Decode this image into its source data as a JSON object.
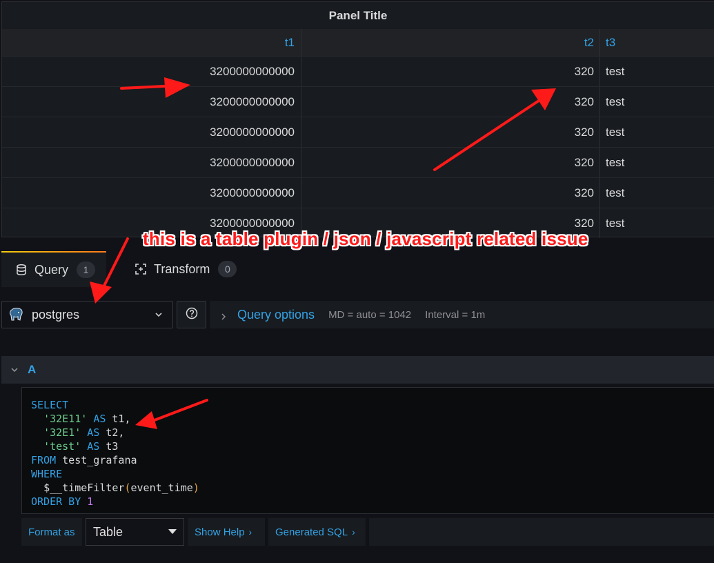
{
  "panel": {
    "title": "Panel Title",
    "columns": [
      "t1",
      "t2",
      "t3"
    ],
    "rows": [
      [
        "3200000000000",
        "320",
        "test"
      ],
      [
        "3200000000000",
        "320",
        "test"
      ],
      [
        "3200000000000",
        "320",
        "test"
      ],
      [
        "3200000000000",
        "320",
        "test"
      ],
      [
        "3200000000000",
        "320",
        "test"
      ],
      [
        "3200000000000",
        "320",
        "test"
      ]
    ]
  },
  "annotation": {
    "text": "this is a table plugin / json / javascript related issue",
    "color": "#ff1a1a"
  },
  "tabs": [
    {
      "label": "Query",
      "count": "1",
      "icon": "database-icon",
      "active": true
    },
    {
      "label": "Transform",
      "count": "0",
      "icon": "transform-icon",
      "active": false
    }
  ],
  "datasource": {
    "name": "postgres",
    "icon": "postgres-elephant-icon"
  },
  "query_options": {
    "label": "Query options",
    "md": "MD = auto = 1042",
    "interval": "Interval = 1m"
  },
  "query_row": {
    "letter": "A"
  },
  "editor": {
    "lines": {
      "l1": "SELECT",
      "l2_str": "'32E11'",
      "l2_as": "AS",
      "l2_alias": "t1,",
      "l3_str": "'32E1'",
      "l3_as": "AS",
      "l3_alias": "t2,",
      "l4_str": "'test'",
      "l4_as": "AS",
      "l4_alias": "t3",
      "l5_kw": "FROM",
      "l5_table": "test_grafana",
      "l6": "WHERE",
      "l7_macro": "$__timeFilter",
      "l7_open": "(",
      "l7_arg": "event_time",
      "l7_close": ")",
      "l8_kw": "ORDER BY",
      "l8_num": "1"
    }
  },
  "bottom": {
    "format_label": "Format as",
    "format_value": "Table",
    "show_help": "Show Help",
    "generated_sql": "Generated SQL",
    "chevron": "›"
  },
  "colors": {
    "accent": "#33a2e5",
    "background": "#111217",
    "panel": "#181b1f",
    "string": "#6ccf8e"
  }
}
